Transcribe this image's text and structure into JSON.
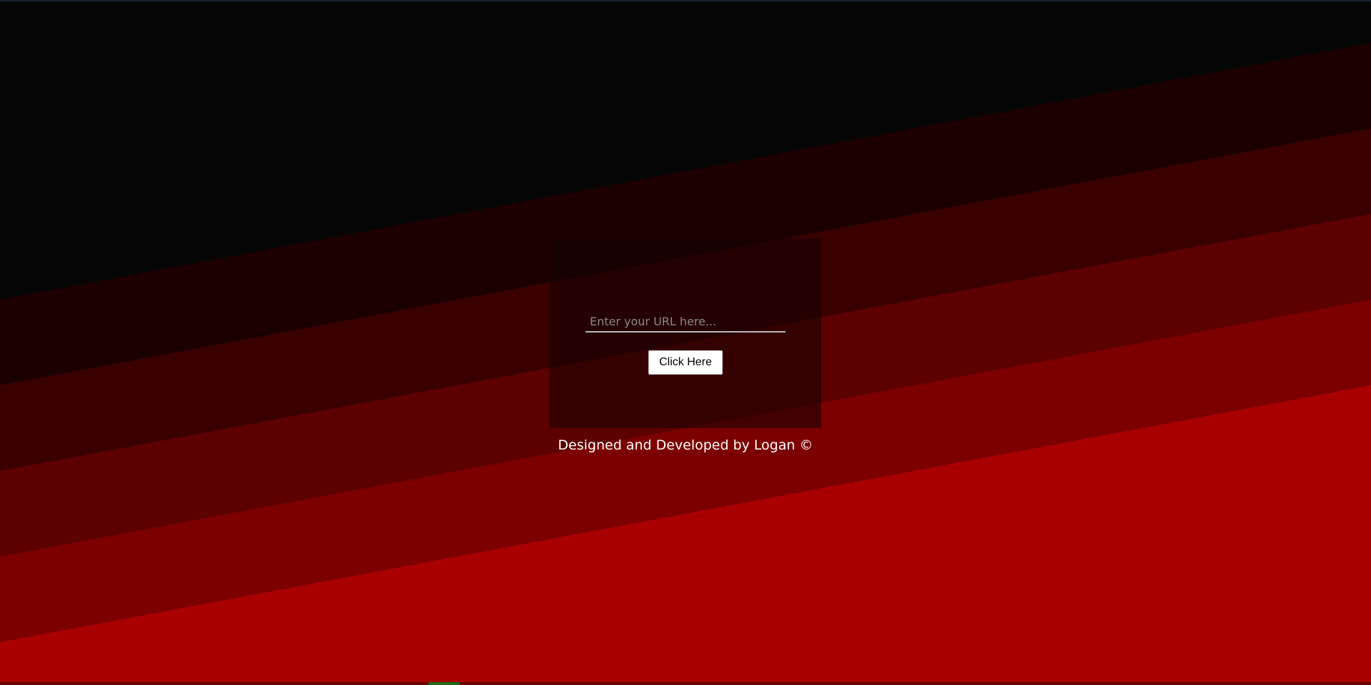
{
  "theme": {
    "background": "#050505",
    "stripe_colors": [
      "#1c0000",
      "#3a0000",
      "#5c0000",
      "#7c0000",
      "#a80000"
    ],
    "panel_color": "#140000",
    "accent": "#a80000"
  },
  "form": {
    "url_placeholder": "Enter your URL here...",
    "url_value": "",
    "button_label": "Click Here"
  },
  "footer": {
    "credit": "Designed and Developed by Logan ©"
  }
}
